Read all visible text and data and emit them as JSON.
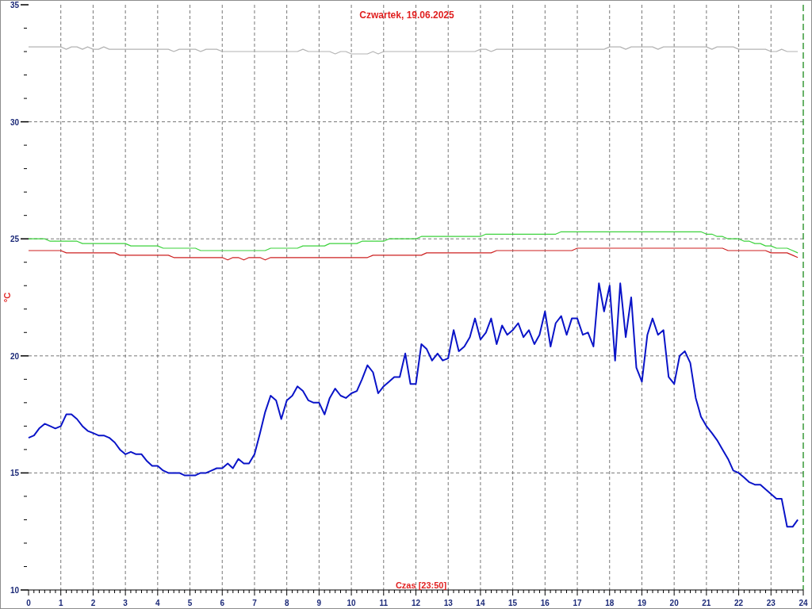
{
  "chart": {
    "chart_data": {
      "type": "line",
      "grid": true,
      "title": "Czwartek, 19.06.2025",
      "xlabel": "Czas [23:50]",
      "ylabel": "°C",
      "xlim": [
        0,
        24
      ],
      "ylim": [
        10,
        35
      ],
      "xticks": [
        0,
        1,
        2,
        3,
        4,
        5,
        6,
        7,
        8,
        9,
        10,
        11,
        12,
        13,
        14,
        15,
        16,
        17,
        18,
        19,
        20,
        21,
        22,
        23,
        24
      ],
      "yticks": [
        10,
        15,
        20,
        25,
        30,
        35
      ],
      "x": [
        0,
        0.17,
        0.33,
        0.5,
        0.67,
        0.83,
        1,
        1.17,
        1.33,
        1.5,
        1.67,
        1.83,
        2,
        2.17,
        2.33,
        2.5,
        2.67,
        2.83,
        3,
        3.17,
        3.33,
        3.5,
        3.67,
        3.83,
        4,
        4.17,
        4.33,
        4.5,
        4.67,
        4.83,
        5,
        5.17,
        5.33,
        5.5,
        5.67,
        5.83,
        6,
        6.17,
        6.33,
        6.5,
        6.67,
        6.83,
        7,
        7.17,
        7.33,
        7.5,
        7.67,
        7.83,
        8,
        8.17,
        8.33,
        8.5,
        8.67,
        8.83,
        9,
        9.17,
        9.33,
        9.5,
        9.67,
        9.83,
        10,
        10.17,
        10.33,
        10.5,
        10.67,
        10.83,
        11,
        11.17,
        11.33,
        11.5,
        11.67,
        11.83,
        12,
        12.17,
        12.33,
        12.5,
        12.67,
        12.83,
        13,
        13.17,
        13.33,
        13.5,
        13.67,
        13.83,
        14,
        14.17,
        14.33,
        14.5,
        14.67,
        14.83,
        15,
        15.17,
        15.33,
        15.5,
        15.67,
        15.83,
        16,
        16.17,
        16.33,
        16.5,
        16.67,
        16.83,
        17,
        17.17,
        17.33,
        17.5,
        17.67,
        17.83,
        18,
        18.17,
        18.33,
        18.5,
        18.67,
        18.83,
        19,
        19.17,
        19.33,
        19.5,
        19.67,
        19.83,
        20,
        20.17,
        20.33,
        20.5,
        20.67,
        20.83,
        21,
        21.17,
        21.33,
        21.5,
        21.67,
        21.83,
        22,
        22.17,
        22.33,
        22.5,
        22.67,
        22.83,
        23,
        23.17,
        23.33,
        23.5,
        23.67,
        23.83
      ],
      "series": [
        {
          "color": "#b4b4b4",
          "values": [
            33.2,
            33.2,
            33.2,
            33.2,
            33.2,
            33.2,
            33.2,
            33.1,
            33.2,
            33.2,
            33.1,
            33.2,
            33.1,
            33.1,
            33.2,
            33.1,
            33.1,
            33.1,
            33.1,
            33.1,
            33.1,
            33.1,
            33.1,
            33.1,
            33.1,
            33.1,
            33.1,
            33.0,
            33.1,
            33.1,
            33.1,
            33.1,
            33.0,
            33.1,
            33.1,
            33.1,
            33.0,
            33.0,
            33.0,
            33.0,
            33.0,
            33.0,
            33.0,
            33.0,
            33.0,
            33.0,
            33.0,
            33.0,
            33.0,
            33.0,
            33.0,
            33.1,
            33.0,
            33.0,
            33.0,
            33.0,
            33.0,
            32.9,
            33.0,
            33.0,
            32.9,
            32.9,
            32.9,
            32.9,
            33.0,
            32.9,
            33.0,
            33.0,
            33.0,
            33.0,
            33.0,
            33.0,
            33.0,
            33.0,
            33.0,
            33.0,
            33.0,
            33.0,
            33.0,
            33.0,
            33.0,
            33.0,
            33.0,
            33.0,
            33.1,
            33.1,
            33.0,
            33.1,
            33.1,
            33.1,
            33.1,
            33.1,
            33.1,
            33.1,
            33.1,
            33.1,
            33.1,
            33.1,
            33.1,
            33.1,
            33.1,
            33.1,
            33.1,
            33.1,
            33.1,
            33.1,
            33.1,
            33.1,
            33.2,
            33.2,
            33.2,
            33.1,
            33.2,
            33.2,
            33.2,
            33.2,
            33.2,
            33.1,
            33.2,
            33.2,
            33.2,
            33.2,
            33.2,
            33.2,
            33.2,
            33.2,
            33.2,
            33.1,
            33.2,
            33.2,
            33.2,
            33.2,
            33.1,
            33.1,
            33.1,
            33.1,
            33.1,
            33.1,
            33.0,
            33.0,
            33.1,
            33.0,
            33.0,
            33.0
          ]
        },
        {
          "color": "#3cd23c",
          "values": [
            25.0,
            25.0,
            25.0,
            25.0,
            24.9,
            24.9,
            24.9,
            24.9,
            24.9,
            24.9,
            24.8,
            24.8,
            24.8,
            24.8,
            24.8,
            24.8,
            24.8,
            24.8,
            24.8,
            24.7,
            24.7,
            24.7,
            24.7,
            24.7,
            24.7,
            24.6,
            24.6,
            24.6,
            24.6,
            24.6,
            24.6,
            24.6,
            24.5,
            24.5,
            24.5,
            24.5,
            24.5,
            24.5,
            24.5,
            24.5,
            24.5,
            24.5,
            24.5,
            24.5,
            24.5,
            24.6,
            24.6,
            24.6,
            24.6,
            24.6,
            24.6,
            24.7,
            24.7,
            24.7,
            24.7,
            24.7,
            24.8,
            24.8,
            24.8,
            24.8,
            24.8,
            24.8,
            24.9,
            24.9,
            24.9,
            24.9,
            24.9,
            25.0,
            25.0,
            25.0,
            25.0,
            25.0,
            25.0,
            25.1,
            25.1,
            25.1,
            25.1,
            25.1,
            25.1,
            25.1,
            25.1,
            25.1,
            25.1,
            25.1,
            25.1,
            25.2,
            25.2,
            25.2,
            25.2,
            25.2,
            25.2,
            25.2,
            25.2,
            25.2,
            25.2,
            25.2,
            25.2,
            25.2,
            25.2,
            25.3,
            25.3,
            25.3,
            25.3,
            25.3,
            25.3,
            25.3,
            25.3,
            25.3,
            25.3,
            25.3,
            25.3,
            25.3,
            25.3,
            25.3,
            25.3,
            25.3,
            25.3,
            25.3,
            25.3,
            25.3,
            25.3,
            25.3,
            25.3,
            25.3,
            25.3,
            25.3,
            25.2,
            25.2,
            25.1,
            25.1,
            25.0,
            25.0,
            25.0,
            24.9,
            24.9,
            24.8,
            24.8,
            24.7,
            24.7,
            24.6,
            24.6,
            24.6,
            24.5,
            24.4
          ]
        },
        {
          "color": "#cd2020",
          "values": [
            24.5,
            24.5,
            24.5,
            24.5,
            24.5,
            24.5,
            24.5,
            24.4,
            24.4,
            24.4,
            24.4,
            24.4,
            24.4,
            24.4,
            24.4,
            24.4,
            24.4,
            24.3,
            24.3,
            24.3,
            24.3,
            24.3,
            24.3,
            24.3,
            24.3,
            24.3,
            24.3,
            24.2,
            24.2,
            24.2,
            24.2,
            24.2,
            24.2,
            24.2,
            24.2,
            24.2,
            24.2,
            24.1,
            24.2,
            24.2,
            24.1,
            24.2,
            24.2,
            24.2,
            24.1,
            24.2,
            24.2,
            24.2,
            24.2,
            24.2,
            24.2,
            24.2,
            24.2,
            24.2,
            24.2,
            24.2,
            24.2,
            24.2,
            24.2,
            24.2,
            24.2,
            24.2,
            24.2,
            24.2,
            24.3,
            24.3,
            24.3,
            24.3,
            24.3,
            24.3,
            24.3,
            24.3,
            24.3,
            24.3,
            24.4,
            24.4,
            24.4,
            24.4,
            24.4,
            24.4,
            24.4,
            24.4,
            24.4,
            24.4,
            24.4,
            24.4,
            24.4,
            24.5,
            24.5,
            24.5,
            24.5,
            24.5,
            24.5,
            24.5,
            24.5,
            24.5,
            24.5,
            24.5,
            24.5,
            24.5,
            24.5,
            24.5,
            24.6,
            24.6,
            24.6,
            24.6,
            24.6,
            24.6,
            24.6,
            24.6,
            24.6,
            24.6,
            24.6,
            24.6,
            24.6,
            24.6,
            24.6,
            24.6,
            24.6,
            24.6,
            24.6,
            24.6,
            24.6,
            24.6,
            24.6,
            24.6,
            24.6,
            24.6,
            24.6,
            24.6,
            24.5,
            24.5,
            24.5,
            24.5,
            24.5,
            24.5,
            24.5,
            24.5,
            24.4,
            24.4,
            24.4,
            24.4,
            24.3,
            24.2
          ]
        },
        {
          "color": "#0a14c8",
          "values": [
            16.5,
            16.6,
            16.9,
            17.1,
            17.0,
            16.9,
            17.0,
            17.5,
            17.5,
            17.3,
            17.0,
            16.8,
            16.7,
            16.6,
            16.6,
            16.5,
            16.3,
            16.0,
            15.8,
            15.9,
            15.8,
            15.8,
            15.5,
            15.3,
            15.3,
            15.1,
            15.0,
            15.0,
            15.0,
            14.9,
            14.9,
            14.9,
            15.0,
            15.0,
            15.1,
            15.2,
            15.2,
            15.4,
            15.2,
            15.6,
            15.4,
            15.4,
            15.8,
            16.7,
            17.6,
            18.3,
            18.1,
            17.3,
            18.1,
            18.3,
            18.7,
            18.5,
            18.1,
            18.0,
            18.0,
            17.5,
            18.2,
            18.6,
            18.3,
            18.2,
            18.4,
            18.5,
            19.0,
            19.6,
            19.3,
            18.4,
            18.7,
            18.9,
            19.1,
            19.1,
            20.1,
            18.8,
            18.8,
            20.5,
            20.3,
            19.8,
            20.1,
            19.8,
            19.9,
            21.1,
            20.2,
            20.4,
            20.8,
            21.6,
            20.7,
            21.0,
            21.6,
            20.5,
            21.3,
            20.9,
            21.1,
            21.4,
            20.8,
            21.1,
            20.5,
            20.9,
            21.9,
            20.4,
            21.4,
            21.7,
            20.9,
            21.6,
            21.6,
            20.9,
            21.0,
            20.4,
            23.1,
            21.9,
            23.0,
            19.8,
            23.1,
            20.8,
            22.5,
            19.5,
            18.9,
            20.9,
            21.6,
            20.9,
            21.1,
            19.1,
            18.8,
            20.0,
            20.2,
            19.7,
            18.2,
            17.4,
            17.0,
            16.7,
            16.4,
            16.0,
            15.6,
            15.1,
            15.0,
            14.8,
            14.6,
            14.5,
            14.5,
            14.3,
            14.1,
            13.9,
            13.9,
            12.7,
            12.7,
            13.0
          ]
        }
      ]
    }
  }
}
